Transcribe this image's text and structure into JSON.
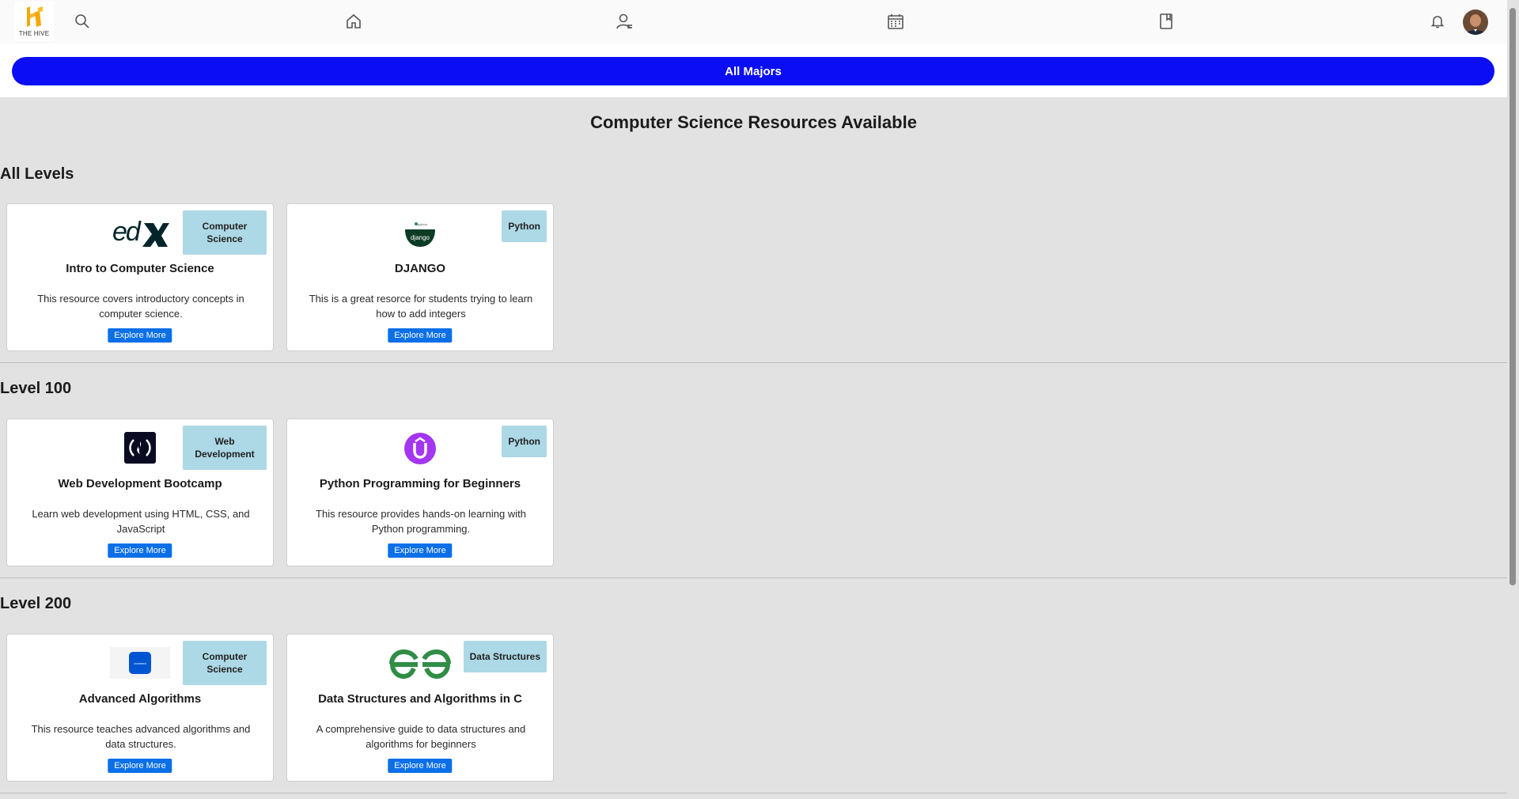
{
  "brand": {
    "name": "THE HIVE"
  },
  "nav": {
    "icons": [
      "search-icon",
      "home-icon",
      "user-icon",
      "calendar-icon",
      "bookmark-icon",
      "bell-icon"
    ]
  },
  "majors_button": "All Majors",
  "page_title": "Computer Science Resources Available",
  "explore_label": "Explore More",
  "sections": [
    {
      "heading": "All Levels",
      "cards": [
        {
          "tag": "Computer Science",
          "logo": "edx-logo",
          "title": "Intro to Computer Science",
          "description": "This resource covers introductory concepts in computer science."
        },
        {
          "tag": "Python",
          "logo": "django-logo",
          "title": "DJANGO",
          "description": "This is a great resorce for students trying to learn how to add integers"
        }
      ]
    },
    {
      "heading": "Level 100",
      "cards": [
        {
          "tag": "Web Development",
          "logo": "freecodecamp-logo",
          "title": "Web Development Bootcamp",
          "description": "Learn web development using HTML, CSS, and JavaScript"
        },
        {
          "tag": "Python",
          "logo": "udemy-logo",
          "title": "Python Programming for Beginners",
          "description": "This resource provides hands-on learning with Python programming."
        }
      ]
    },
    {
      "heading": "Level 200",
      "cards": [
        {
          "tag": "Computer Science",
          "logo": "coursera-logo",
          "title": "Advanced Algorithms",
          "description": "This resource teaches advanced algorithms and data structures."
        },
        {
          "tag": "Data Structures",
          "logo": "geeksforgeeks-logo",
          "title": "Data Structures and Algorithms in C",
          "description": "A comprehensive guide to data structures and algorithms for beginners"
        }
      ]
    }
  ],
  "colors": {
    "primary": "#0b0ef5",
    "explore_button": "#0b6fe8",
    "tag_bg": "#add8e6",
    "page_bg": "#e2e2e2",
    "logo_accent": "#f5a800"
  }
}
